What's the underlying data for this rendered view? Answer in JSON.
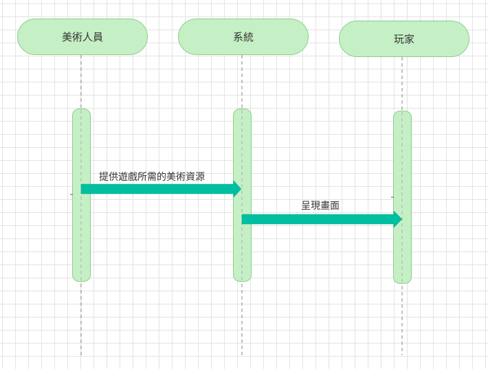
{
  "colors": {
    "participant_fill": "#c5f0c5",
    "participant_border": "#8ccc8c",
    "arrow": "#00bfa0",
    "lifeline": "#999999",
    "grid": "#e3e3e3"
  },
  "participants": [
    {
      "label": "美術人員"
    },
    {
      "label": "系統"
    },
    {
      "label": "玩家"
    }
  ],
  "messages": [
    {
      "label": "提供遊戲所需的美術資源",
      "from": "美術人員",
      "to": "系統"
    },
    {
      "label": "呈現畫面",
      "from": "系統",
      "to": "玩家"
    }
  ]
}
